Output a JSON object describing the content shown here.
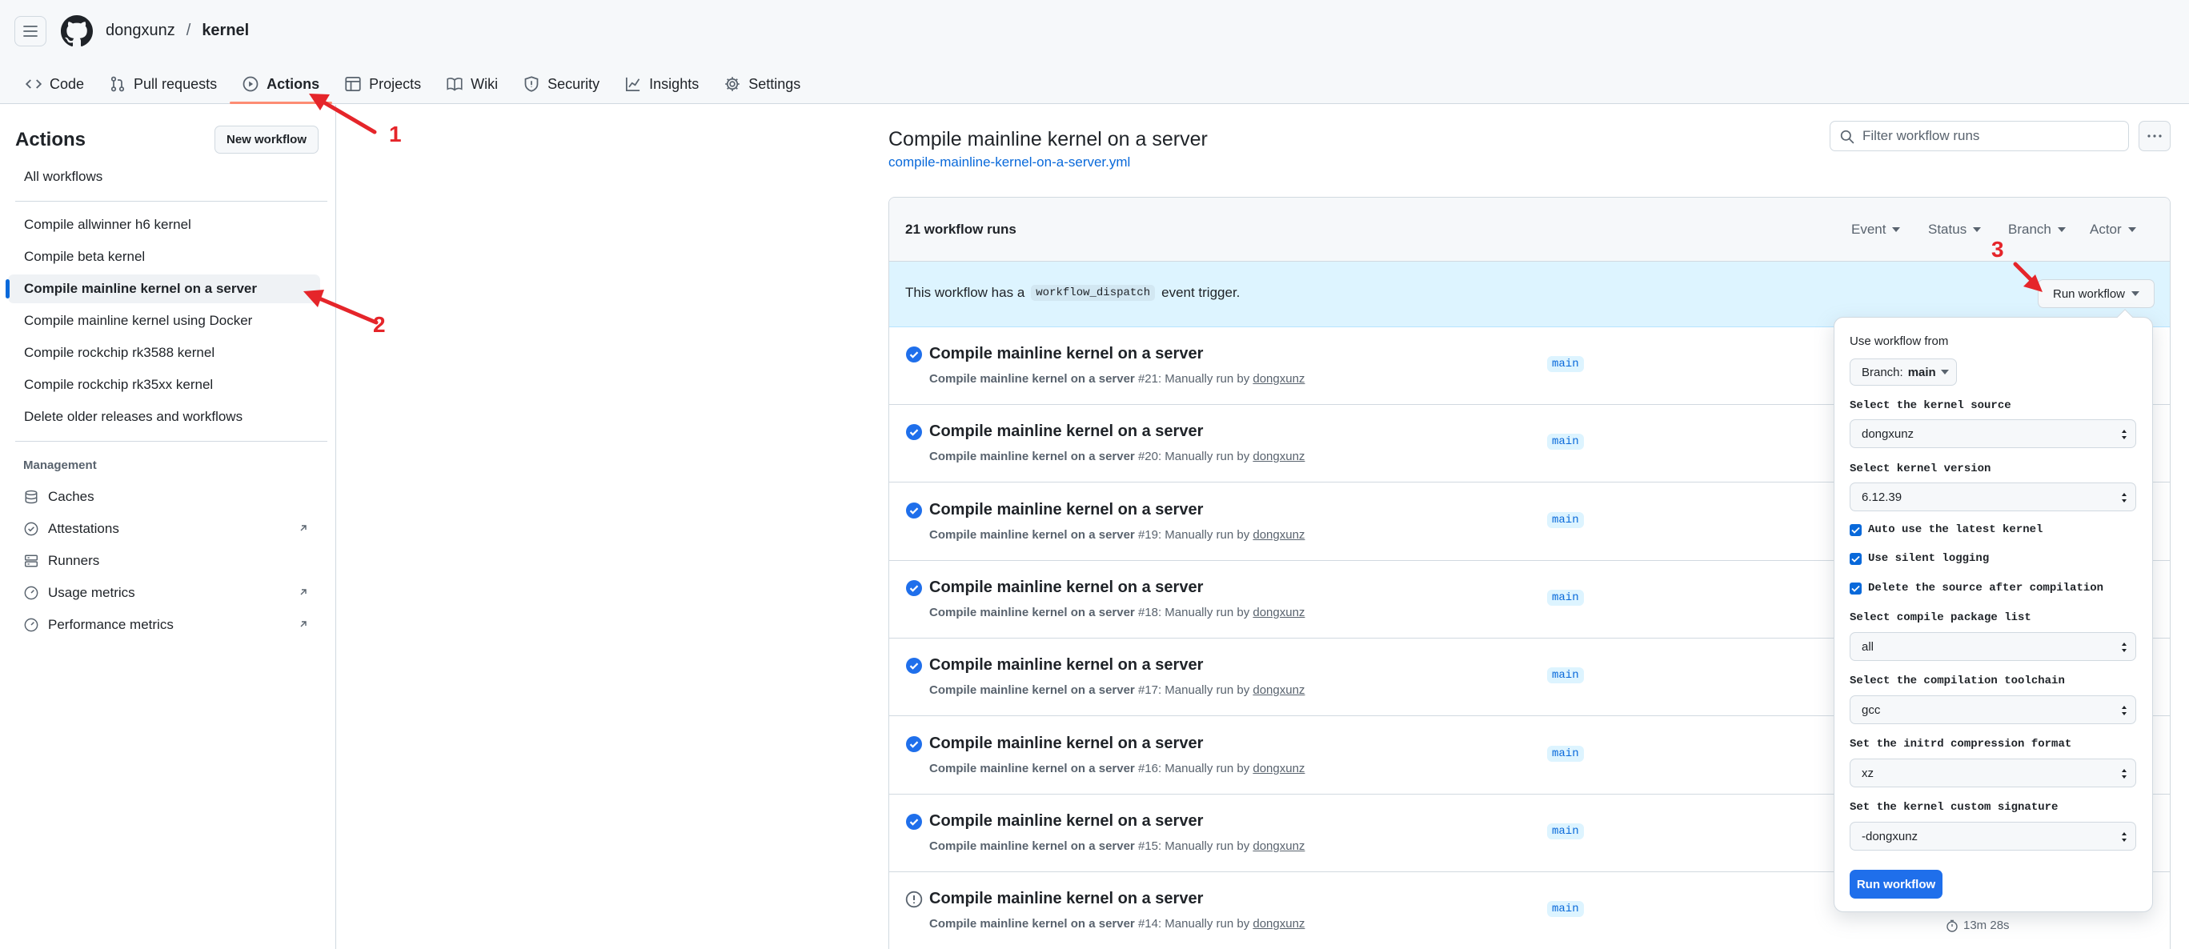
{
  "header": {
    "owner": "dongxunz",
    "separator": "/",
    "repo": "kernel",
    "tabs": [
      {
        "label": "Code",
        "icon": "code-icon"
      },
      {
        "label": "Pull requests",
        "icon": "pull-request-icon"
      },
      {
        "label": "Actions",
        "icon": "play-icon"
      },
      {
        "label": "Projects",
        "icon": "table-icon"
      },
      {
        "label": "Wiki",
        "icon": "book-icon"
      },
      {
        "label": "Security",
        "icon": "shield-icon"
      },
      {
        "label": "Insights",
        "icon": "graph-icon"
      },
      {
        "label": "Settings",
        "icon": "gear-icon"
      }
    ]
  },
  "sidebar": {
    "title": "Actions",
    "new_workflow": "New workflow",
    "all_workflows": "All workflows",
    "workflows": [
      "Compile allwinner h6 kernel",
      "Compile beta kernel",
      "Compile mainline kernel on a server",
      "Compile mainline kernel using Docker",
      "Compile rockchip rk3588 kernel",
      "Compile rockchip rk35xx kernel",
      "Delete older releases and workflows"
    ],
    "management_heading": "Management",
    "management": [
      {
        "label": "Caches",
        "icon": "database-icon"
      },
      {
        "label": "Attestations",
        "icon": "verified-icon"
      },
      {
        "label": "Runners",
        "icon": "server-icon"
      },
      {
        "label": "Usage metrics",
        "icon": "meter-icon"
      },
      {
        "label": "Performance metrics",
        "icon": "meter-icon"
      }
    ]
  },
  "main": {
    "title": "Compile mainline kernel on a server",
    "file": "compile-mainline-kernel-on-a-server.yml",
    "filter_placeholder": "Filter workflow runs",
    "runs_count": "21 workflow runs",
    "filters": [
      "Event",
      "Status",
      "Branch",
      "Actor"
    ],
    "dispatch_prefix": "This workflow has a",
    "dispatch_code": "workflow_dispatch",
    "dispatch_suffix": "event trigger.",
    "run_workflow_btn": "Run workflow",
    "runs": [
      {
        "title": "Compile mainline kernel on a server",
        "wf": "Compile mainline kernel on a server",
        "num": "#21",
        "trigger": ": Manually run by",
        "author": "dongxunz",
        "branch": "main",
        "status": "success"
      },
      {
        "title": "Compile mainline kernel on a server",
        "wf": "Compile mainline kernel on a server",
        "num": "#20",
        "trigger": ": Manually run by",
        "author": "dongxunz",
        "branch": "main",
        "status": "success"
      },
      {
        "title": "Compile mainline kernel on a server",
        "wf": "Compile mainline kernel on a server",
        "num": "#19",
        "trigger": ": Manually run by",
        "author": "dongxunz",
        "branch": "main",
        "status": "success"
      },
      {
        "title": "Compile mainline kernel on a server",
        "wf": "Compile mainline kernel on a server",
        "num": "#18",
        "trigger": ": Manually run by",
        "author": "dongxunz",
        "branch": "main",
        "status": "success"
      },
      {
        "title": "Compile mainline kernel on a server",
        "wf": "Compile mainline kernel on a server",
        "num": "#17",
        "trigger": ": Manually run by",
        "author": "dongxunz",
        "branch": "main",
        "status": "success"
      },
      {
        "title": "Compile mainline kernel on a server",
        "wf": "Compile mainline kernel on a server",
        "num": "#16",
        "trigger": ": Manually run by",
        "author": "dongxunz",
        "branch": "main",
        "status": "success"
      },
      {
        "title": "Compile mainline kernel on a server",
        "wf": "Compile mainline kernel on a server",
        "num": "#15",
        "trigger": ": Manually run by",
        "author": "dongxunz",
        "branch": "main",
        "status": "success"
      },
      {
        "title": "Compile mainline kernel on a server",
        "wf": "Compile mainline kernel on a server",
        "num": "#14",
        "trigger": ": Manually run by",
        "author": "dongxunz",
        "branch": "main",
        "status": "neutral",
        "duration": "13m 28s"
      }
    ]
  },
  "dropdown": {
    "use_from": "Use workflow from",
    "branch_prefix": "Branch:",
    "branch_value": "main",
    "source_label": "Select the kernel source",
    "source_value": "dongxunz",
    "version_label": "Select kernel version",
    "version_value": "6.12.39",
    "check_auto": "Auto use the latest kernel",
    "check_silent": "Use silent logging",
    "check_delete": "Delete the source after compilation",
    "package_label": "Select compile package list",
    "package_value": "all",
    "toolchain_label": "Select the compilation toolchain",
    "toolchain_value": "gcc",
    "initrd_label": "Set the initrd compression format",
    "initrd_value": "xz",
    "signature_label": "Set the kernel custom signature",
    "signature_value": "-dongxunz",
    "submit": "Run workflow"
  },
  "annotations": {
    "one": "1",
    "two": "2",
    "three": "3"
  },
  "colors": {
    "accent": "#0969da",
    "success": "#1f6feb",
    "annotation": "#e5252a",
    "tab_underline": "#fd8c73"
  }
}
